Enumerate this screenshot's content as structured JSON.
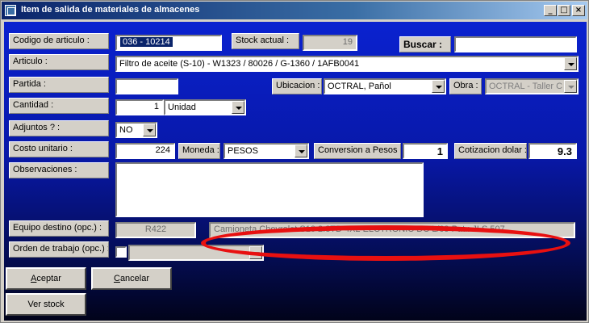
{
  "window": {
    "title": "Item de salida de materiales de almacenes",
    "minimize_glyph": "_",
    "maximize_glyph": "□",
    "close_glyph": "×"
  },
  "codigo": {
    "label": "Codigo de articulo :",
    "value": "036 - 10214"
  },
  "stock": {
    "label": "Stock actual :",
    "value": "19"
  },
  "buscar": {
    "label": "Buscar :",
    "value": ""
  },
  "articulo": {
    "label": "Articulo :",
    "value": "Filtro de aceite (S-10) - W1323 / 80026 / G-1360 / 1AFB0041"
  },
  "partida": {
    "label": "Partida :",
    "value": ""
  },
  "ubicacion": {
    "label": "Ubicacion :",
    "value": "OCTRAL, Pañol"
  },
  "obra": {
    "label": "Obra :",
    "value": "OCTRAL - Taller C"
  },
  "cantidad": {
    "label": "Cantidad :",
    "value": "1",
    "unit": "Unidad"
  },
  "adjuntos": {
    "label": "Adjuntos ? :",
    "value": "NO"
  },
  "costo": {
    "label": "Costo unitario :",
    "value": "224"
  },
  "moneda": {
    "label": "Moneda :",
    "value": "PESOS"
  },
  "conversion": {
    "label": "Conversion a Pesos :",
    "value": "1"
  },
  "cotizacion": {
    "label": "Cotizacion dolar :",
    "value": "9.3"
  },
  "observaciones": {
    "label": "Observaciones :",
    "value": ""
  },
  "equipo": {
    "label": "Equipo destino (opc.) :",
    "code": "R422",
    "description": "Camioneta Chevrolet S10 2.8TD 4X2 ELCTRONIC DC L/09 Pat.: JLS 507"
  },
  "orden": {
    "label": "Orden de trabajo (opc.) :",
    "value": ""
  },
  "buttons": {
    "aceptar_first": "A",
    "aceptar_rest": "ceptar",
    "cancelar_first": "C",
    "cancelar_rest": "ancelar",
    "ver_stock": "Ver stock"
  },
  "colors": {
    "client_top": "#0a22d0",
    "client_bottom": "#01031a",
    "highlight_ring": "#e81010",
    "selection": "#0a246a"
  }
}
